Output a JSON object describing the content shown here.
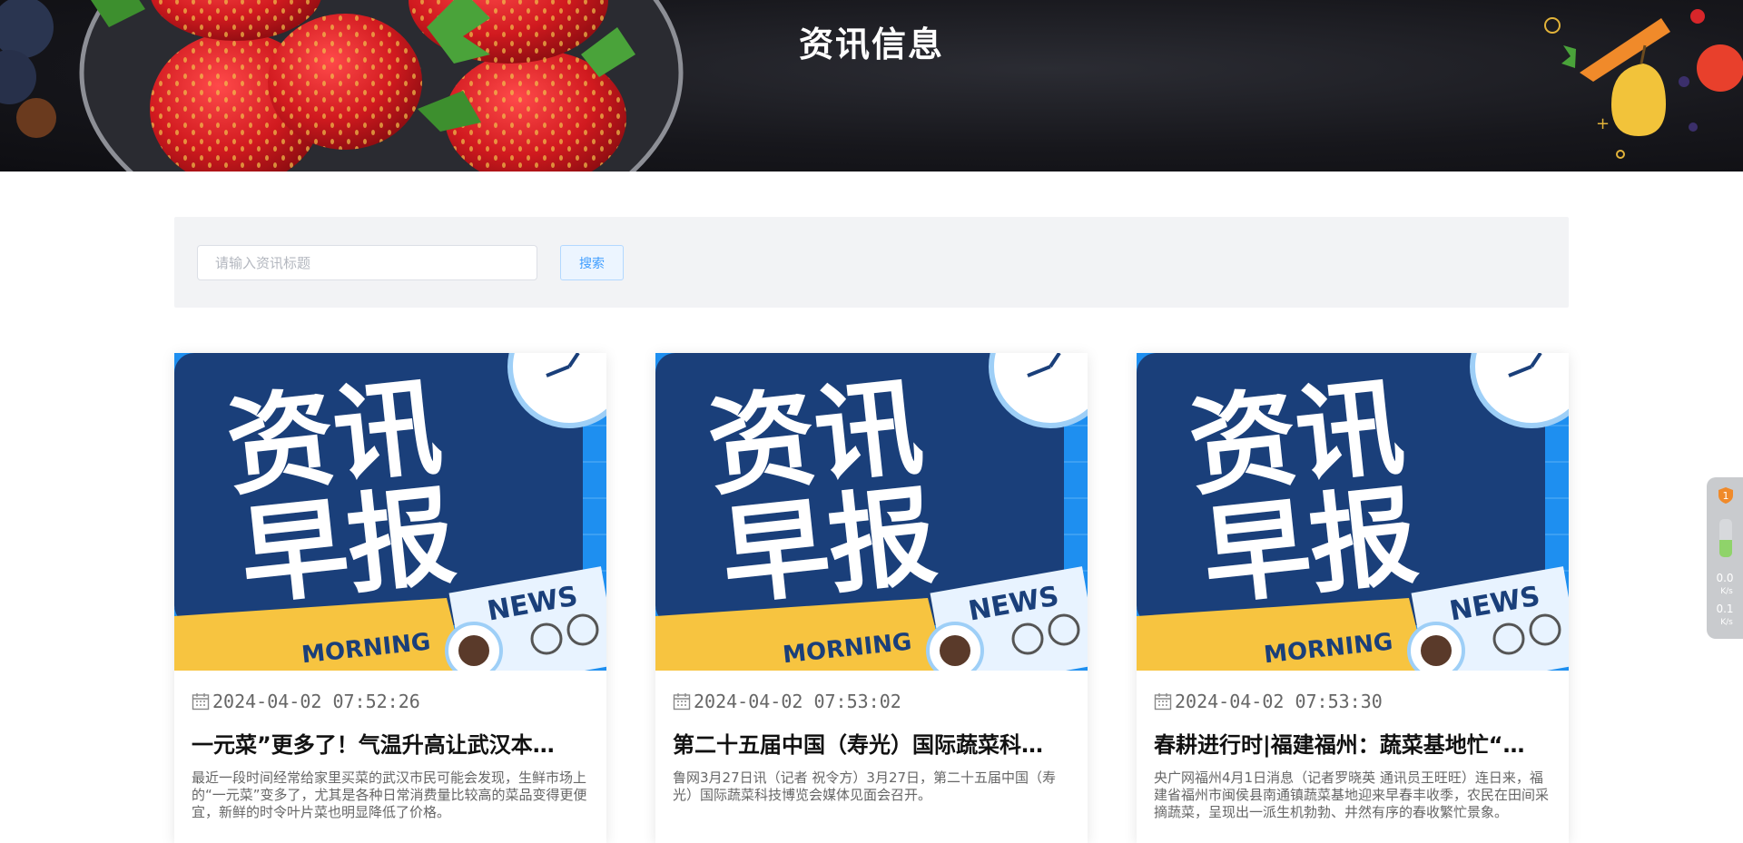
{
  "header": {
    "title": "资讯信息"
  },
  "search": {
    "placeholder": "请输入资讯标题",
    "value": "",
    "button_label": "搜索"
  },
  "cards": [
    {
      "image_text": {
        "big_line1": "资讯",
        "big_line2": "早报",
        "ribbon": "MORNING",
        "paper": "NEWS"
      },
      "date": "2024-04-02 07:52:26",
      "title": "一元菜”更多了！气温升高让武汉本…",
      "desc": "最近一段时间经常给家里买菜的武汉市民可能会发现，生鲜市场上的“一元菜”变多了，尤其是各种日常消费量比较高的菜品变得更便宜，新鲜的时令叶片菜也明显降低了价格。"
    },
    {
      "image_text": {
        "big_line1": "资讯",
        "big_line2": "早报",
        "ribbon": "MORNING",
        "paper": "NEWS"
      },
      "date": "2024-04-02 07:53:02",
      "title": "第二十五届中国（寿光）国际蔬菜科…",
      "desc": "鲁网3月27日讯（记者 祝令方）3月27日，第二十五届中国（寿光）国际蔬菜科技博览会媒体见面会召开。"
    },
    {
      "image_text": {
        "big_line1": "资讯",
        "big_line2": "早报",
        "ribbon": "MORNING",
        "paper": "NEWS"
      },
      "date": "2024-04-02 07:53:30",
      "title": "春耕进行时|福建福州：蔬菜基地忙“…",
      "desc": "央广网福州4月1日消息（记者罗晓英 通讯员王旺旺）连日来，福建省福州市闽侯县南通镇蔬菜基地迎来早春丰收季，农民在田间采摘蔬菜，呈现出一派生机勃勃、井然有序的春收繁忙景象。"
    }
  ],
  "widget": {
    "badge": "1",
    "up_speed": "0.0",
    "up_unit": "K/s",
    "down_speed": "0.1",
    "down_unit": "K/s"
  },
  "colors": {
    "accent": "#409eff",
    "banner_bg": "#17171c",
    "card_image_blue": "#1e8ff0",
    "card_board_navy": "#1a3f7a",
    "ribbon_yellow": "#f7c440"
  },
  "icons": {
    "date": "calendar-icon",
    "widget_badge": "shield-icon"
  }
}
